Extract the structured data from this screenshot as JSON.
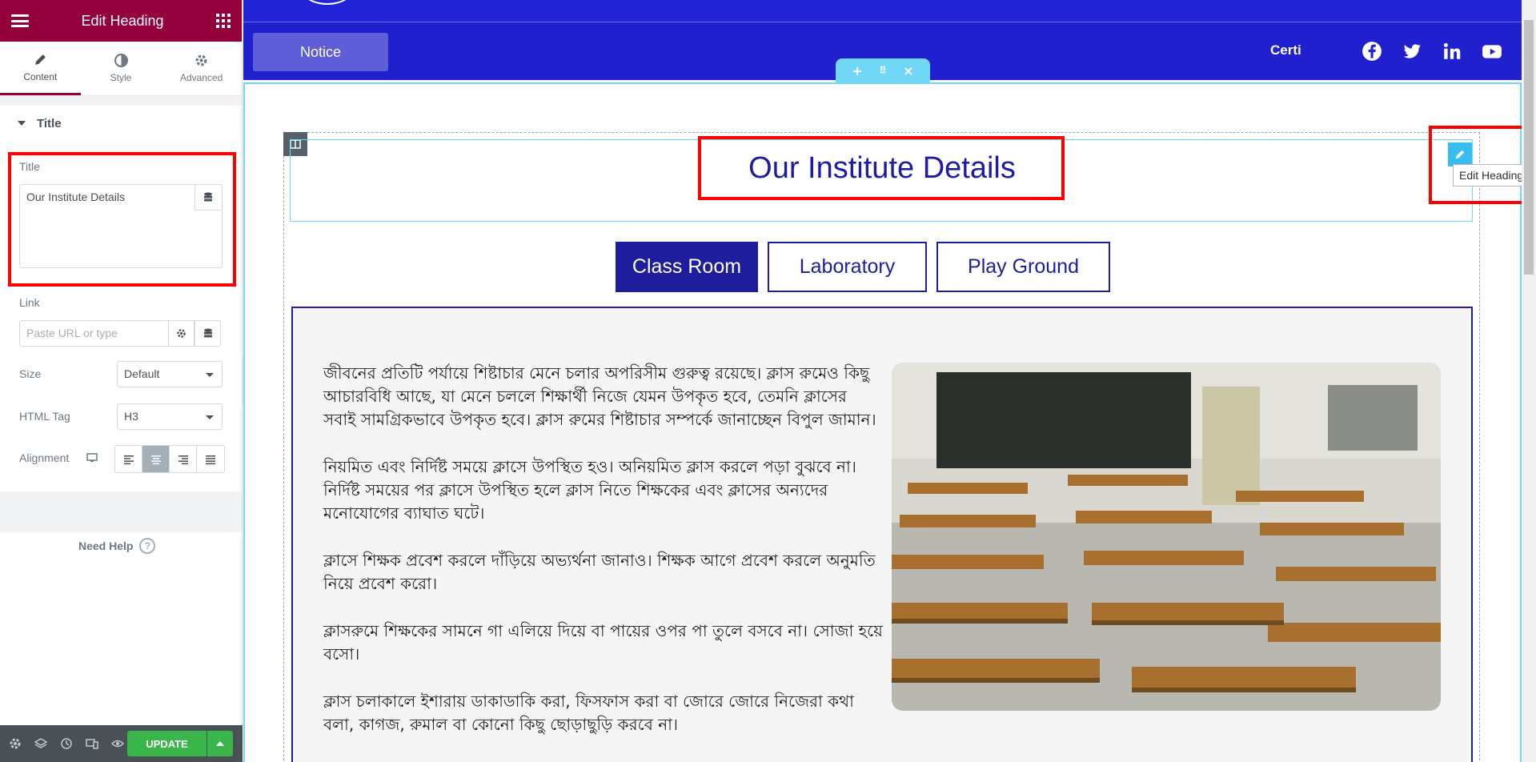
{
  "panel": {
    "title": "Edit Heading",
    "tabs": [
      {
        "label": "Content"
      },
      {
        "label": "Style"
      },
      {
        "label": "Advanced"
      }
    ],
    "section_title": "Title",
    "title_field": {
      "label": "Title",
      "value": "Our Institute Details"
    },
    "link_field": {
      "label": "Link",
      "placeholder": "Paste URL or type"
    },
    "size": {
      "label": "Size",
      "value": "Default"
    },
    "html_tag": {
      "label": "HTML Tag",
      "value": "H3"
    },
    "alignment": {
      "label": "Alignment",
      "selected": "center"
    },
    "need_help": "Need Help",
    "update_label": "UPDATE"
  },
  "site": {
    "notice_label": "Notice",
    "certi_label": "Certi",
    "social": [
      "facebook-icon",
      "twitter-icon",
      "linkedin-icon",
      "youtube-icon"
    ]
  },
  "widget": {
    "heading": "Our Institute Details",
    "tooltip": "Edit Heading"
  },
  "tabs": [
    {
      "label": "Class Room",
      "active": true
    },
    {
      "label": "Laboratory",
      "active": false
    },
    {
      "label": "Play Ground",
      "active": false
    }
  ],
  "paragraphs": [
    "জীবনের প্রতিটি পর্যায়ে শিষ্টাচার মেনে চলার অপরিসীম গুরুত্ব রয়েছে। ক্লাস রুমেও কিছু আচারবিধি আছে, যা মেনে চললে শিক্ষার্থী নিজে যেমন উপকৃত হবে, তেমনি ক্লাসের সবাই সামগ্রিকভাবে উপকৃত হবে। ক্লাস রুমের শিষ্টাচার সম্পর্কে জানাচ্ছেন বিপুল জামান।",
    "নিয়মিত এবং নির্দিষ্ট সময়ে ক্লাসে উপস্থিত হও। অনিয়মিত ক্লাস করলে পড়া বুঝবে না। নির্দিষ্ট সময়ের পর ক্লাসে উপস্থিত হলে ক্লাস নিতে শিক্ষকের এবং ক্লাসের অন্যদের মনোযোগের ব্যাঘাত ঘটে।",
    "ক্লাসে শিক্ষক প্রবেশ করলে দাঁড়িয়ে অভ্যর্থনা জানাও। শিক্ষক আগে প্রবেশ করলে অনুমতি নিয়ে প্রবেশ করো।",
    "ক্লাসরুমে শিক্ষকের সামনে গা এলিয়ে দিয়ে বা পায়ের ওপর পা তুলে বসবে না। সোজা হয়ে বসো।",
    "ক্লাস চলাকালে ইশারায় ডাকাডাকি করা, ফিসফাস করা বা জোরে জোরে নিজেরা কথা বলা, কাগজ, রুমাল বা কোনো কিছু ছোড়াছুড়ি করবে না।"
  ],
  "colors": {
    "editor_accent": "#93003c",
    "site_blue": "#1d1d9e",
    "update_green": "#39b54a",
    "highlight_red": "#ff0000"
  }
}
